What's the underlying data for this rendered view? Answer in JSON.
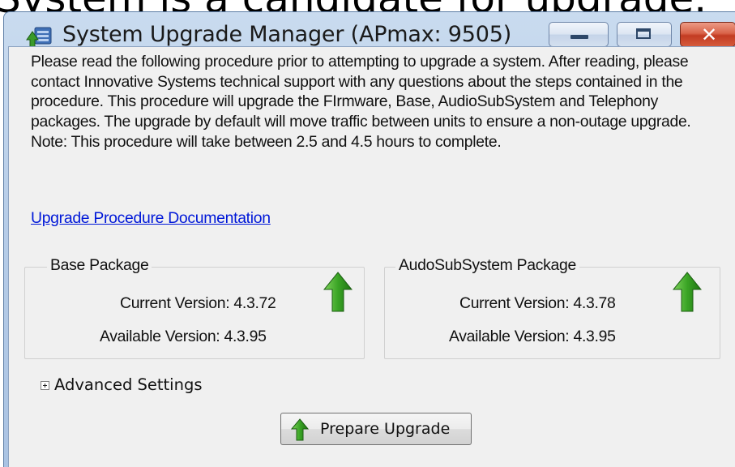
{
  "background_text": "System is a candidate for upgrade.",
  "window": {
    "title": "System Upgrade Manager (APmax: 9505)",
    "app_icon": "server-upgrade-icon"
  },
  "description": "Please read the following procedure prior to attempting to upgrade a system. After reading, please contact Innovative Systems technical support with any questions about the steps contained in the procedure. This procedure will upgrade the FIrmware, Base, AudioSubSystem and Telephony packages. The upgrade by default will move traffic between units to ensure a non-outage upgrade. Note: This procedure will take between 2.5 and 4.5 hours to complete.",
  "doc_link": "Upgrade Procedure Documentation",
  "base_package": {
    "title": "Base Package",
    "current": "Current Version: 4.3.72",
    "available": "Available Version: 4.3.95",
    "icon": "green-up-arrow-icon"
  },
  "audio_package": {
    "title": "AudoSubSystem Package",
    "current": "Current Version: 4.3.78",
    "available": "Available Version: 4.3.95",
    "icon": "green-up-arrow-icon"
  },
  "advanced": {
    "label": "Advanced Settings",
    "expanded": false
  },
  "prepare_button": {
    "label": "Prepare Upgrade",
    "icon": "green-up-arrow-icon"
  },
  "colors": {
    "link": "#0018d8",
    "arrow": "#2e8b1e",
    "close": "#c23b22"
  }
}
